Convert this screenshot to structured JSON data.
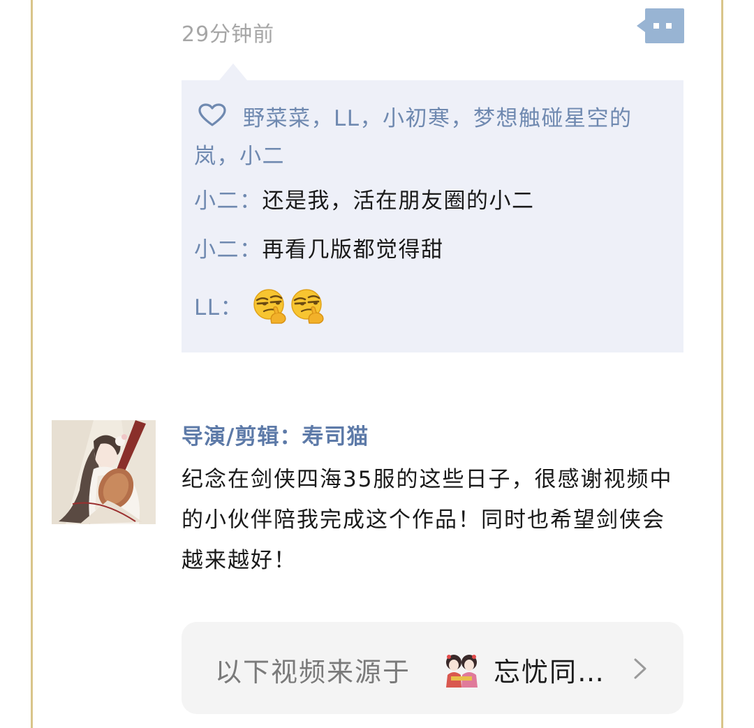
{
  "post_top": {
    "timestamp": "29分钟前"
  },
  "interactions": {
    "likes_text": "野菜菜，LL，小初寒，梦想触碰星空的岚，小二",
    "comments": [
      {
        "author": "小二：",
        "text": "还是我，活在朋友圈的小二"
      },
      {
        "author": "小二：",
        "text": "再看几版都觉得甜"
      },
      {
        "author": "LL：",
        "emoji": [
          "smirk-face-icon",
          "smirk-face-icon"
        ]
      }
    ]
  },
  "post": {
    "author": "导演/剪辑：寿司猫",
    "text": "纪念在剑侠四海35服的这些日子，很感谢视频中的小伙伴陪我完成这个作品！同时也希望剑侠会越来越好！"
  },
  "video_source": {
    "prefix": "以下视频来源于",
    "name": "忘忧同…"
  },
  "colors": {
    "accent": "#6f89b0",
    "more_button": "#98b4d3",
    "interaction_bg": "#eef0f8",
    "frame_gold": "#d9c58a"
  }
}
